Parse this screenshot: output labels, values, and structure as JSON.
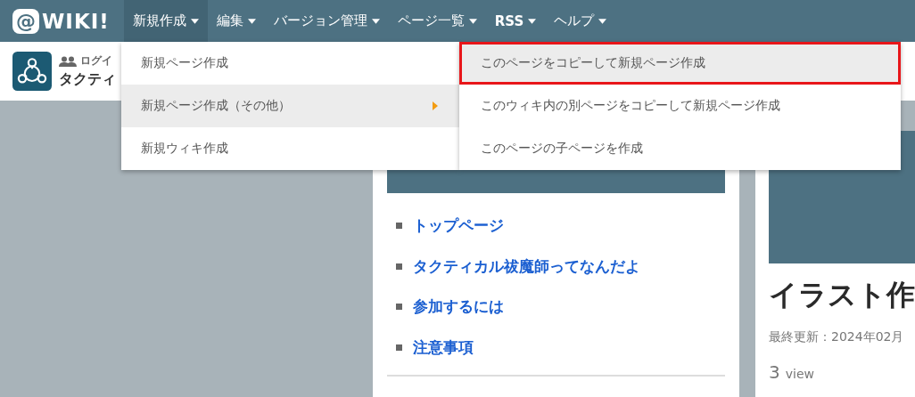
{
  "logo": {
    "mark": "@",
    "text": "WIKI!"
  },
  "nav": [
    {
      "label": "新規作成",
      "selected": true,
      "bold": false
    },
    {
      "label": "編集",
      "selected": false,
      "bold": false
    },
    {
      "label": "バージョン管理",
      "selected": false,
      "bold": false
    },
    {
      "label": "ページ一覧",
      "selected": false,
      "bold": false
    },
    {
      "label": "RSS",
      "selected": false,
      "bold": true
    },
    {
      "label": "ヘルプ",
      "selected": false,
      "bold": false
    }
  ],
  "site_header": {
    "login": "ログイ",
    "title": "タクティ"
  },
  "menu": [
    {
      "label": "新規ページ作成",
      "selected": false,
      "has_submenu": false
    },
    {
      "label": "新規ページ作成（その他）",
      "selected": true,
      "has_submenu": true
    },
    {
      "label": "新規ウィキ作成",
      "selected": false,
      "has_submenu": false
    }
  ],
  "submenu": [
    {
      "label": "このページをコピーして新規ページ作成",
      "selected": true,
      "highlighted": true
    },
    {
      "label": "このウィキ内の別ページをコピーして新規ページ作成",
      "selected": false,
      "highlighted": false
    },
    {
      "label": "このページの子ページを作成",
      "selected": false,
      "highlighted": false
    }
  ],
  "sidebar": {
    "links": [
      "トップページ",
      "タクティカル祓魔師ってなんだよ",
      "参加するには",
      "注意事項"
    ]
  },
  "article": {
    "title": "イラスト作",
    "updated": "最終更新：2024年02月",
    "views_count": "3",
    "views_unit": "view"
  }
}
